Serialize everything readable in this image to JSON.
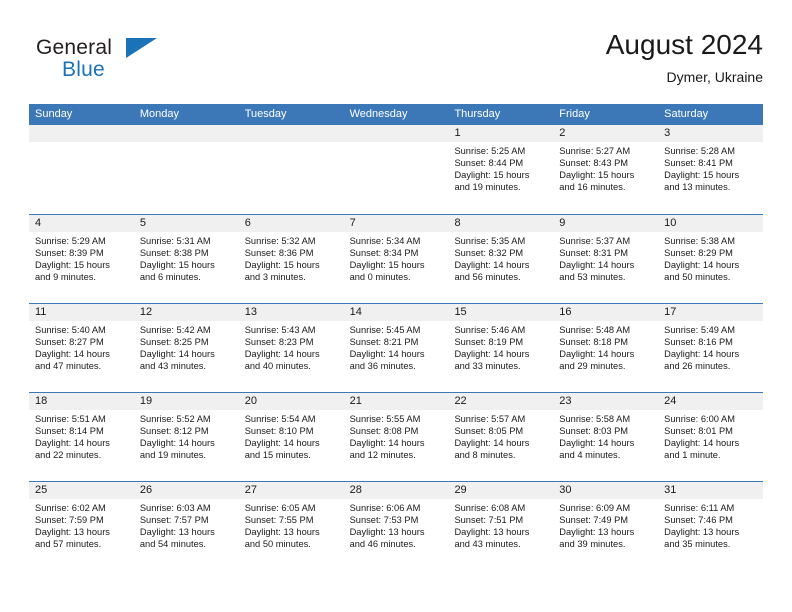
{
  "brand": {
    "name_top": "General",
    "name_bottom": "Blue",
    "accent_color": "#1b72b8"
  },
  "header": {
    "title": "August 2024",
    "subtitle": "Dymer, Ukraine"
  },
  "calendar": {
    "header_color": "#3c78b8",
    "day_band_color": "#f0f0f0",
    "weekday_labels": [
      "Sunday",
      "Monday",
      "Tuesday",
      "Wednesday",
      "Thursday",
      "Friday",
      "Saturday"
    ],
    "weeks": [
      [
        {
          "day": "",
          "sunrise": "",
          "sunset": "",
          "daylight_1": "",
          "daylight_2": "",
          "empty": true
        },
        {
          "day": "",
          "sunrise": "",
          "sunset": "",
          "daylight_1": "",
          "daylight_2": "",
          "empty": true
        },
        {
          "day": "",
          "sunrise": "",
          "sunset": "",
          "daylight_1": "",
          "daylight_2": "",
          "empty": true
        },
        {
          "day": "",
          "sunrise": "",
          "sunset": "",
          "daylight_1": "",
          "daylight_2": "",
          "empty": true
        },
        {
          "day": "1",
          "sunrise": "Sunrise: 5:25 AM",
          "sunset": "Sunset: 8:44 PM",
          "daylight_1": "Daylight: 15 hours",
          "daylight_2": "and 19 minutes.",
          "empty": false
        },
        {
          "day": "2",
          "sunrise": "Sunrise: 5:27 AM",
          "sunset": "Sunset: 8:43 PM",
          "daylight_1": "Daylight: 15 hours",
          "daylight_2": "and 16 minutes.",
          "empty": false
        },
        {
          "day": "3",
          "sunrise": "Sunrise: 5:28 AM",
          "sunset": "Sunset: 8:41 PM",
          "daylight_1": "Daylight: 15 hours",
          "daylight_2": "and 13 minutes.",
          "empty": false
        }
      ],
      [
        {
          "day": "4",
          "sunrise": "Sunrise: 5:29 AM",
          "sunset": "Sunset: 8:39 PM",
          "daylight_1": "Daylight: 15 hours",
          "daylight_2": "and 9 minutes.",
          "empty": false
        },
        {
          "day": "5",
          "sunrise": "Sunrise: 5:31 AM",
          "sunset": "Sunset: 8:38 PM",
          "daylight_1": "Daylight: 15 hours",
          "daylight_2": "and 6 minutes.",
          "empty": false
        },
        {
          "day": "6",
          "sunrise": "Sunrise: 5:32 AM",
          "sunset": "Sunset: 8:36 PM",
          "daylight_1": "Daylight: 15 hours",
          "daylight_2": "and 3 minutes.",
          "empty": false
        },
        {
          "day": "7",
          "sunrise": "Sunrise: 5:34 AM",
          "sunset": "Sunset: 8:34 PM",
          "daylight_1": "Daylight: 15 hours",
          "daylight_2": "and 0 minutes.",
          "empty": false
        },
        {
          "day": "8",
          "sunrise": "Sunrise: 5:35 AM",
          "sunset": "Sunset: 8:32 PM",
          "daylight_1": "Daylight: 14 hours",
          "daylight_2": "and 56 minutes.",
          "empty": false
        },
        {
          "day": "9",
          "sunrise": "Sunrise: 5:37 AM",
          "sunset": "Sunset: 8:31 PM",
          "daylight_1": "Daylight: 14 hours",
          "daylight_2": "and 53 minutes.",
          "empty": false
        },
        {
          "day": "10",
          "sunrise": "Sunrise: 5:38 AM",
          "sunset": "Sunset: 8:29 PM",
          "daylight_1": "Daylight: 14 hours",
          "daylight_2": "and 50 minutes.",
          "empty": false
        }
      ],
      [
        {
          "day": "11",
          "sunrise": "Sunrise: 5:40 AM",
          "sunset": "Sunset: 8:27 PM",
          "daylight_1": "Daylight: 14 hours",
          "daylight_2": "and 47 minutes.",
          "empty": false
        },
        {
          "day": "12",
          "sunrise": "Sunrise: 5:42 AM",
          "sunset": "Sunset: 8:25 PM",
          "daylight_1": "Daylight: 14 hours",
          "daylight_2": "and 43 minutes.",
          "empty": false
        },
        {
          "day": "13",
          "sunrise": "Sunrise: 5:43 AM",
          "sunset": "Sunset: 8:23 PM",
          "daylight_1": "Daylight: 14 hours",
          "daylight_2": "and 40 minutes.",
          "empty": false
        },
        {
          "day": "14",
          "sunrise": "Sunrise: 5:45 AM",
          "sunset": "Sunset: 8:21 PM",
          "daylight_1": "Daylight: 14 hours",
          "daylight_2": "and 36 minutes.",
          "empty": false
        },
        {
          "day": "15",
          "sunrise": "Sunrise: 5:46 AM",
          "sunset": "Sunset: 8:19 PM",
          "daylight_1": "Daylight: 14 hours",
          "daylight_2": "and 33 minutes.",
          "empty": false
        },
        {
          "day": "16",
          "sunrise": "Sunrise: 5:48 AM",
          "sunset": "Sunset: 8:18 PM",
          "daylight_1": "Daylight: 14 hours",
          "daylight_2": "and 29 minutes.",
          "empty": false
        },
        {
          "day": "17",
          "sunrise": "Sunrise: 5:49 AM",
          "sunset": "Sunset: 8:16 PM",
          "daylight_1": "Daylight: 14 hours",
          "daylight_2": "and 26 minutes.",
          "empty": false
        }
      ],
      [
        {
          "day": "18",
          "sunrise": "Sunrise: 5:51 AM",
          "sunset": "Sunset: 8:14 PM",
          "daylight_1": "Daylight: 14 hours",
          "daylight_2": "and 22 minutes.",
          "empty": false
        },
        {
          "day": "19",
          "sunrise": "Sunrise: 5:52 AM",
          "sunset": "Sunset: 8:12 PM",
          "daylight_1": "Daylight: 14 hours",
          "daylight_2": "and 19 minutes.",
          "empty": false
        },
        {
          "day": "20",
          "sunrise": "Sunrise: 5:54 AM",
          "sunset": "Sunset: 8:10 PM",
          "daylight_1": "Daylight: 14 hours",
          "daylight_2": "and 15 minutes.",
          "empty": false
        },
        {
          "day": "21",
          "sunrise": "Sunrise: 5:55 AM",
          "sunset": "Sunset: 8:08 PM",
          "daylight_1": "Daylight: 14 hours",
          "daylight_2": "and 12 minutes.",
          "empty": false
        },
        {
          "day": "22",
          "sunrise": "Sunrise: 5:57 AM",
          "sunset": "Sunset: 8:05 PM",
          "daylight_1": "Daylight: 14 hours",
          "daylight_2": "and 8 minutes.",
          "empty": false
        },
        {
          "day": "23",
          "sunrise": "Sunrise: 5:58 AM",
          "sunset": "Sunset: 8:03 PM",
          "daylight_1": "Daylight: 14 hours",
          "daylight_2": "and 4 minutes.",
          "empty": false
        },
        {
          "day": "24",
          "sunrise": "Sunrise: 6:00 AM",
          "sunset": "Sunset: 8:01 PM",
          "daylight_1": "Daylight: 14 hours",
          "daylight_2": "and 1 minute.",
          "empty": false
        }
      ],
      [
        {
          "day": "25",
          "sunrise": "Sunrise: 6:02 AM",
          "sunset": "Sunset: 7:59 PM",
          "daylight_1": "Daylight: 13 hours",
          "daylight_2": "and 57 minutes.",
          "empty": false
        },
        {
          "day": "26",
          "sunrise": "Sunrise: 6:03 AM",
          "sunset": "Sunset: 7:57 PM",
          "daylight_1": "Daylight: 13 hours",
          "daylight_2": "and 54 minutes.",
          "empty": false
        },
        {
          "day": "27",
          "sunrise": "Sunrise: 6:05 AM",
          "sunset": "Sunset: 7:55 PM",
          "daylight_1": "Daylight: 13 hours",
          "daylight_2": "and 50 minutes.",
          "empty": false
        },
        {
          "day": "28",
          "sunrise": "Sunrise: 6:06 AM",
          "sunset": "Sunset: 7:53 PM",
          "daylight_1": "Daylight: 13 hours",
          "daylight_2": "and 46 minutes.",
          "empty": false
        },
        {
          "day": "29",
          "sunrise": "Sunrise: 6:08 AM",
          "sunset": "Sunset: 7:51 PM",
          "daylight_1": "Daylight: 13 hours",
          "daylight_2": "and 43 minutes.",
          "empty": false
        },
        {
          "day": "30",
          "sunrise": "Sunrise: 6:09 AM",
          "sunset": "Sunset: 7:49 PM",
          "daylight_1": "Daylight: 13 hours",
          "daylight_2": "and 39 minutes.",
          "empty": false
        },
        {
          "day": "31",
          "sunrise": "Sunrise: 6:11 AM",
          "sunset": "Sunset: 7:46 PM",
          "daylight_1": "Daylight: 13 hours",
          "daylight_2": "and 35 minutes.",
          "empty": false
        }
      ]
    ]
  }
}
